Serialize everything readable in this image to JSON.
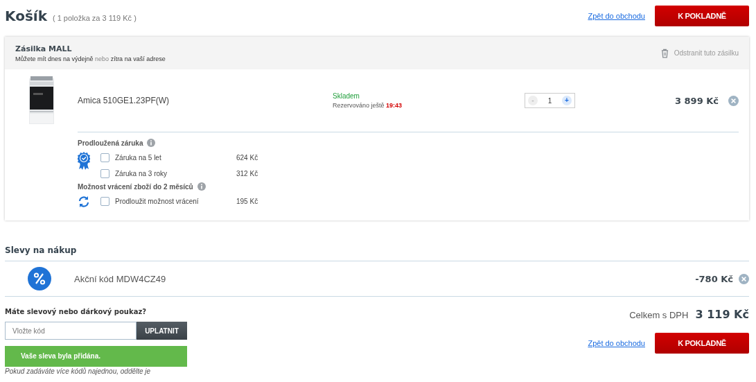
{
  "header": {
    "title": "Košík",
    "summary": "( 1 položka za 3 119 Kč )",
    "back_link": "Zpět do obchodu",
    "checkout_button": "K POKLADNĚ"
  },
  "shipment": {
    "title": "Zásilka MALL",
    "subtitle_parts": [
      {
        "text": "Můžete mít dnes na výdejně",
        "muted": false
      },
      {
        "text": "nebo",
        "muted": true
      },
      {
        "text": "zítra na vaší adrese",
        "muted": false
      }
    ],
    "remove_label": "Odstranit tuto zásilku",
    "item": {
      "name": "Amica 510GE1.23PF(W)",
      "stock": "Skladem",
      "reserved_label": "Rezervováno ještě",
      "reserved_time": "19:43",
      "decrement": "-",
      "decrement_disabled": true,
      "quantity": "1",
      "increment": "+",
      "price": "3 899 Kč"
    },
    "services": [
      {
        "title": "Prodloužená záruka",
        "kind": "warranty",
        "options": [
          {
            "label": "Záruka na 5 let",
            "price": "624 Kč",
            "checked": false
          },
          {
            "label": "Záruka na 3 roky",
            "price": "312 Kč",
            "checked": false
          }
        ]
      },
      {
        "title": "Možnost vrácení zboží do 2 měsíců",
        "kind": "return",
        "options": [
          {
            "label": "Prodloužit možnost vrácení",
            "price": "195 Kč",
            "checked": false
          }
        ]
      }
    ]
  },
  "discounts": {
    "title": "Slevy na nákup",
    "items": [
      {
        "label": "Akční kód MDW4CZ49",
        "amount": "-780 Kč"
      }
    ]
  },
  "coupon": {
    "title": "Máte slevový nebo dárkový poukaz?",
    "placeholder": "Vložte kód",
    "apply_button": "UPLATNIT",
    "success_message": "Vaše sleva byla přidána.",
    "note": "Pokud zadáváte více kódů najednou, oddělte je"
  },
  "total": {
    "label": "Celkem s DPH",
    "value": "3 119 Kč"
  },
  "footer": {
    "back_link": "Zpět do obchodu",
    "checkout_button": "K POKLADNĚ"
  }
}
